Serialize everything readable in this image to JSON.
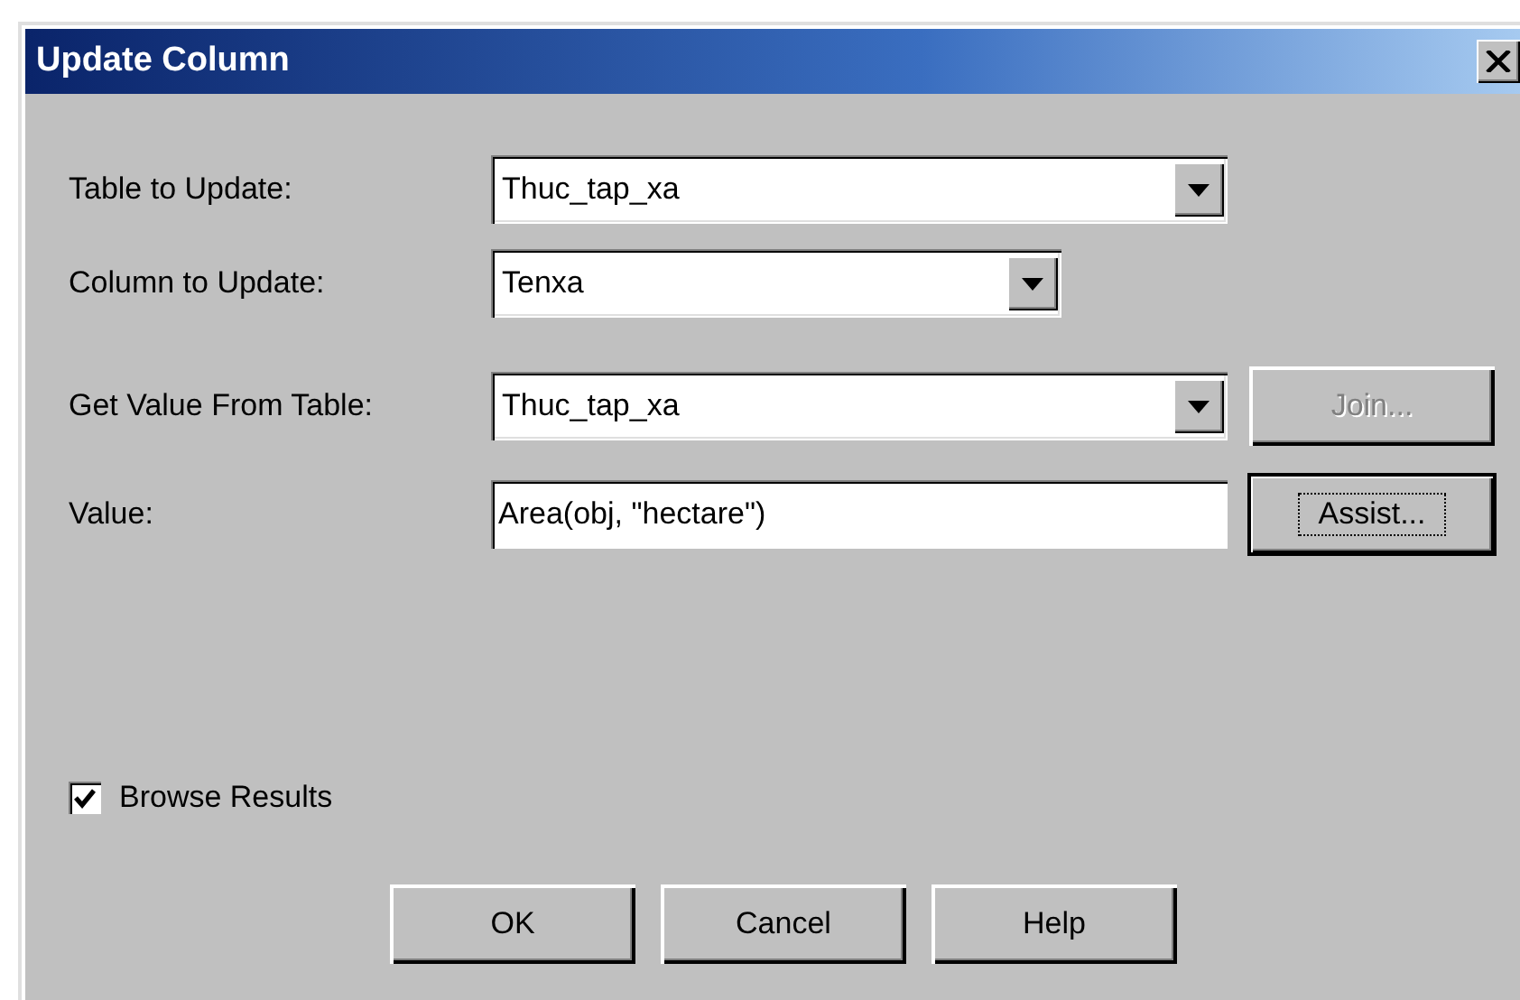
{
  "window": {
    "title": "Update Column"
  },
  "fields": [
    {
      "kind": "combo",
      "label": "Table to Update:",
      "value": "Thuc_tap_xa"
    },
    {
      "kind": "combo",
      "label": "Column to Update:",
      "value": "Tenxa"
    },
    {
      "kind": "combo",
      "label": "Get Value From Table:",
      "value": "Thuc_tap_xa",
      "button": {
        "label": "Join...",
        "disabled": true,
        "focused": false
      }
    },
    {
      "kind": "text",
      "label": "Value:",
      "value": "Area(obj, \"hectare\")",
      "button": {
        "label": "Assist...",
        "disabled": false,
        "focused": true
      }
    }
  ],
  "checkbox": {
    "label": "Browse Results",
    "checked": true
  },
  "buttons": [
    {
      "label": "OK"
    },
    {
      "label": "Cancel"
    },
    {
      "label": "Help"
    }
  ]
}
